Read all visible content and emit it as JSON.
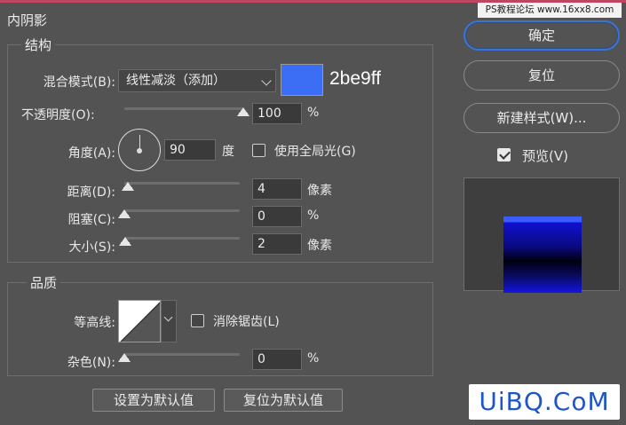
{
  "panel": {
    "title": "内阴影",
    "structure_title": "结构",
    "quality_title": "品质"
  },
  "blend": {
    "label": "混合模式(B):",
    "value": "线性减淡（添加）",
    "color": "#3b6df5",
    "color_hex_label": "2be9ff"
  },
  "opacity": {
    "label": "不透明度(O):",
    "value": "100",
    "unit": "%",
    "level": 1.0
  },
  "angle": {
    "label": "角度(A):",
    "value": "90",
    "unit": "度",
    "global_light_label": "使用全局光(G)",
    "global_light_checked": false
  },
  "distance": {
    "label": "距离(D):",
    "value": "4",
    "unit": "像素",
    "level": 0.03
  },
  "choke": {
    "label": "阻塞(C):",
    "value": "0",
    "unit": "%",
    "level": 0.0
  },
  "size": {
    "label": "大小(S):",
    "value": "2",
    "unit": "像素",
    "level": 0.01
  },
  "contour": {
    "label": "等高线:",
    "antialias_label": "消除锯齿(L)",
    "antialias_checked": false
  },
  "noise": {
    "label": "杂色(N):",
    "value": "0",
    "unit": "%",
    "level": 0.0
  },
  "buttons": {
    "set_default": "设置为默认值",
    "reset_default": "复位为默认值",
    "ok": "确定",
    "reset": "复位",
    "new_style": "新建样式(W)...",
    "preview_label": "预览(V)",
    "preview_checked": true
  },
  "watermark": "PS教程论坛 www.16xx8.com",
  "logo": "UiBQ.CoM"
}
